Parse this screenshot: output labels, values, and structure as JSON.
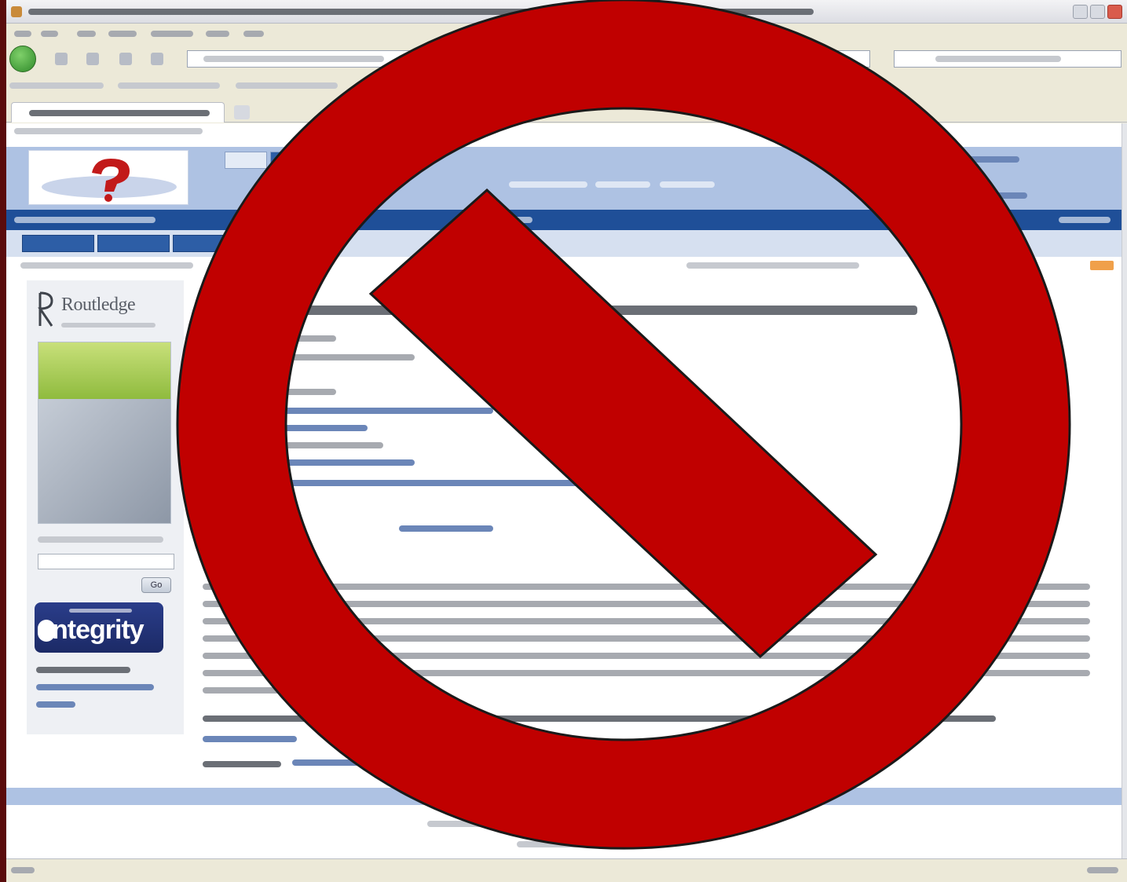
{
  "colors": {
    "frame": "#5a0c0c",
    "sign_red": "#c00000",
    "sign_outline": "#1a1a1a",
    "site_header": "#aec2e3",
    "site_nav": "#1f4f98"
  },
  "sidebar": {
    "publisher_name": "Routledge",
    "search_button": "Go",
    "banner_word": "ntegrity"
  },
  "icons": {
    "prohibition": "prohibition-icon",
    "back": "back-arrow-icon",
    "logo": "question-mark-logo-icon"
  }
}
